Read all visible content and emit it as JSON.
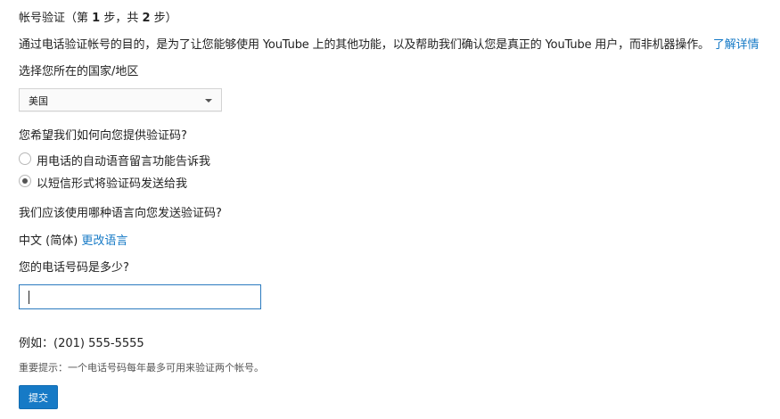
{
  "header": {
    "title_prefix": "帐号验证（第 ",
    "step_current": "1",
    "title_mid": " 步，共 ",
    "step_total": "2",
    "title_suffix": " 步）"
  },
  "intro": {
    "text": "通过电话验证帐号的目的，是为了让您能够使用 YouTube 上的其他功能，以及帮助我们确认您是真正的 YouTube 用户，而非机器操作。",
    "learn_more": "了解详情"
  },
  "country": {
    "label": "选择您所在的国家/地区",
    "selected": "美国"
  },
  "method": {
    "label": "您希望我们如何向您提供验证码?",
    "options": [
      {
        "label": "用电话的自动语音留言功能告诉我",
        "checked": false
      },
      {
        "label": "以短信形式将验证码发送给我",
        "checked": true
      }
    ]
  },
  "language": {
    "label": "我们应该使用哪种语言向您发送验证码?",
    "current": "中文 (简体)",
    "change_link": "更改语言"
  },
  "phone": {
    "label": "您的电话号码是多少?",
    "value": "",
    "example": "例如：(201) 555-5555",
    "tip": "重要提示：一个电话号码每年最多可用来验证两个帐号。"
  },
  "submit": {
    "label": "提交"
  },
  "colors": {
    "accent": "#167ac6",
    "input_focus": "#2b7bbf"
  }
}
